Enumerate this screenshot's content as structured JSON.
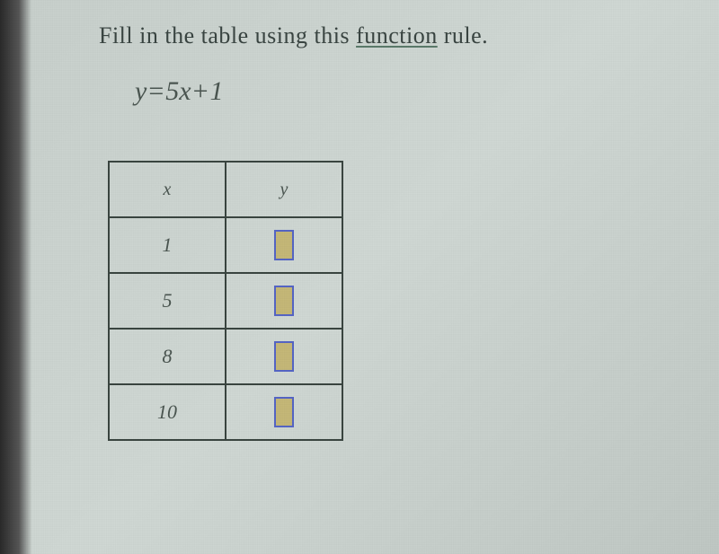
{
  "instruction": {
    "prefix": "Fill in the table using this ",
    "link_text": "function",
    "suffix": " rule."
  },
  "equation": {
    "lhs": "y",
    "eq": "=",
    "coef": "5",
    "var": "x",
    "op": "+",
    "const": "1"
  },
  "table": {
    "headers": {
      "col1": "x",
      "col2": "y"
    },
    "rows": [
      {
        "x": "1",
        "y": ""
      },
      {
        "x": "5",
        "y": ""
      },
      {
        "x": "8",
        "y": ""
      },
      {
        "x": "10",
        "y": ""
      }
    ]
  },
  "chart_data": {
    "type": "table",
    "title": "Function table for y = 5x + 1",
    "columns": [
      "x",
      "y"
    ],
    "rows": [
      {
        "x": 1,
        "y": null
      },
      {
        "x": 5,
        "y": null
      },
      {
        "x": 8,
        "y": null
      },
      {
        "x": 10,
        "y": null
      }
    ]
  }
}
